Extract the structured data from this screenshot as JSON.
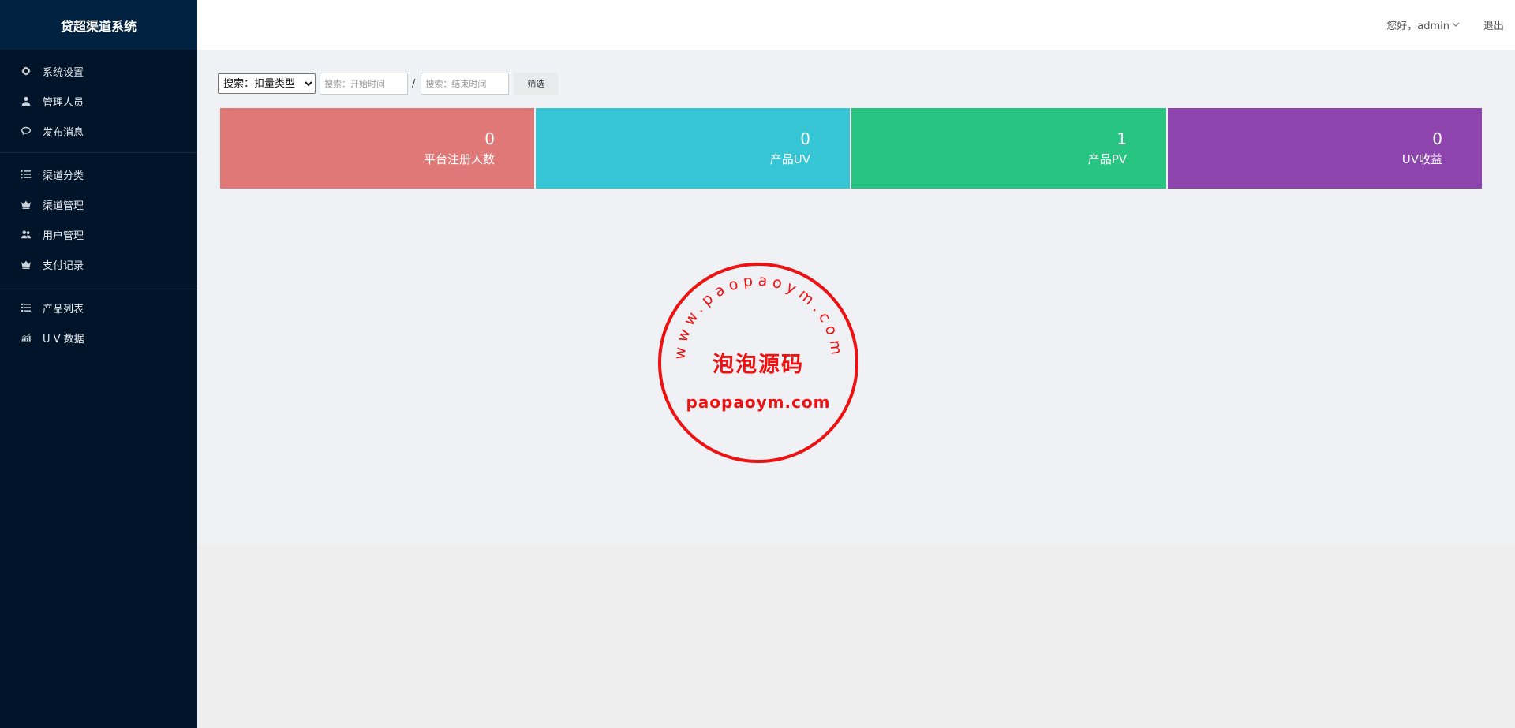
{
  "app": {
    "title": "贷超渠道系统"
  },
  "sidebar": {
    "groups": [
      [
        {
          "label": "系统设置",
          "icon": "gear-icon"
        },
        {
          "label": "管理人员",
          "icon": "user-icon"
        },
        {
          "label": "发布消息",
          "icon": "comment-icon"
        }
      ],
      [
        {
          "label": "渠道分类",
          "icon": "list-ordered-icon"
        },
        {
          "label": "渠道管理",
          "icon": "crown-icon"
        },
        {
          "label": "用户管理",
          "icon": "users-icon"
        },
        {
          "label": "支付记录",
          "icon": "crown-icon"
        }
      ],
      [
        {
          "label": "产品列表",
          "icon": "list-icon"
        },
        {
          "label": "U V 数据",
          "icon": "chart-icon"
        }
      ]
    ]
  },
  "header": {
    "greeting": "您好，admin",
    "logout": "退出"
  },
  "filters": {
    "type_select": "搜索：扣量类型",
    "start_placeholder": "搜索：开始时间",
    "separator": "/",
    "end_placeholder": "搜索：结束时间",
    "submit": "筛选"
  },
  "stats": [
    {
      "value": "0",
      "label": "平台注册人数",
      "color": "#e07878"
    },
    {
      "value": "0",
      "label": "产品UV",
      "color": "#35c5d5"
    },
    {
      "value": "1",
      "label": "产品PV",
      "color": "#27c482"
    },
    {
      "value": "0",
      "label": "UV收益",
      "color": "#8e44ad"
    }
  ],
  "watermark": {
    "ring_text": "www.paopaoym.com",
    "name": "泡泡源码",
    "domain": "paopaoym.com",
    "color": "#ee1111"
  }
}
